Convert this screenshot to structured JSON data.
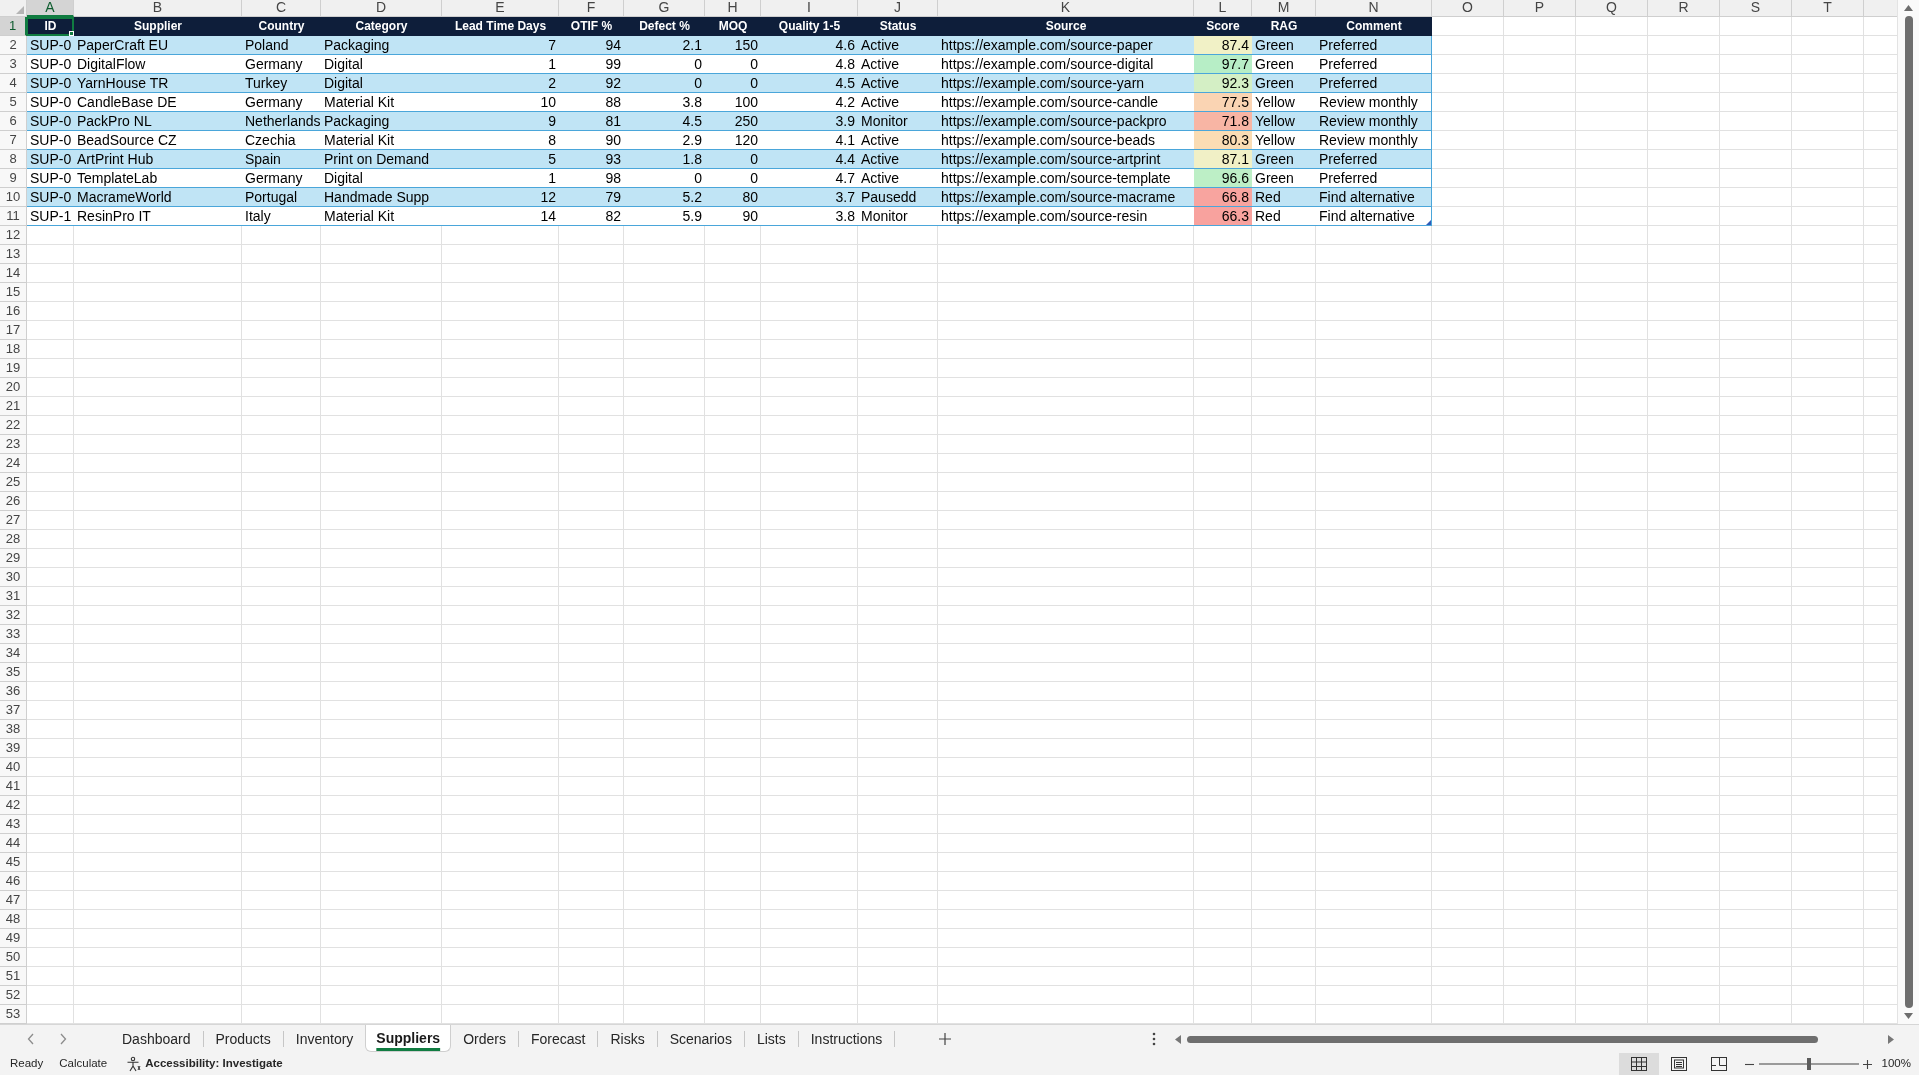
{
  "sheet": {
    "column_letters": [
      {
        "label": "A",
        "selected": true
      },
      {
        "label": "B",
        "selected": false
      },
      {
        "label": "C",
        "selected": false
      },
      {
        "label": "D",
        "selected": false
      },
      {
        "label": "E",
        "selected": false
      },
      {
        "label": "F",
        "selected": false
      },
      {
        "label": "G",
        "selected": false
      },
      {
        "label": "H",
        "selected": false
      },
      {
        "label": "I",
        "selected": false
      },
      {
        "label": "J",
        "selected": false
      },
      {
        "label": "K",
        "selected": false
      },
      {
        "label": "L",
        "selected": false
      },
      {
        "label": "M",
        "selected": false
      },
      {
        "label": "N",
        "selected": false
      },
      {
        "label": "O",
        "selected": false
      },
      {
        "label": "P",
        "selected": false
      },
      {
        "label": "Q",
        "selected": false
      },
      {
        "label": "R",
        "selected": false
      },
      {
        "label": "S",
        "selected": false
      },
      {
        "label": "T",
        "selected": false
      }
    ],
    "row_numbers": [
      {
        "label": "1",
        "selected": true
      },
      {
        "label": "2",
        "selected": false
      },
      {
        "label": "3",
        "selected": false
      },
      {
        "label": "4",
        "selected": false
      },
      {
        "label": "5",
        "selected": false
      },
      {
        "label": "6",
        "selected": false
      },
      {
        "label": "7",
        "selected": false
      },
      {
        "label": "8",
        "selected": false
      },
      {
        "label": "9",
        "selected": false
      },
      {
        "label": "10",
        "selected": false
      },
      {
        "label": "11",
        "selected": false
      },
      {
        "label": "12",
        "selected": false
      },
      {
        "label": "13",
        "selected": false
      },
      {
        "label": "14",
        "selected": false
      },
      {
        "label": "15",
        "selected": false
      },
      {
        "label": "16",
        "selected": false
      },
      {
        "label": "17",
        "selected": false
      },
      {
        "label": "18",
        "selected": false
      },
      {
        "label": "19",
        "selected": false
      },
      {
        "label": "20",
        "selected": false
      },
      {
        "label": "21",
        "selected": false
      },
      {
        "label": "22",
        "selected": false
      },
      {
        "label": "23",
        "selected": false
      },
      {
        "label": "24",
        "selected": false
      },
      {
        "label": "25",
        "selected": false
      },
      {
        "label": "26",
        "selected": false
      },
      {
        "label": "27",
        "selected": false
      },
      {
        "label": "28",
        "selected": false
      },
      {
        "label": "29",
        "selected": false
      },
      {
        "label": "30",
        "selected": false
      },
      {
        "label": "31",
        "selected": false
      },
      {
        "label": "32",
        "selected": false
      },
      {
        "label": "33",
        "selected": false
      },
      {
        "label": "34",
        "selected": false
      },
      {
        "label": "35",
        "selected": false
      },
      {
        "label": "36",
        "selected": false
      },
      {
        "label": "37",
        "selected": false
      },
      {
        "label": "38",
        "selected": false
      },
      {
        "label": "39",
        "selected": false
      },
      {
        "label": "40",
        "selected": false
      },
      {
        "label": "41",
        "selected": false
      },
      {
        "label": "42",
        "selected": false
      },
      {
        "label": "43",
        "selected": false
      },
      {
        "label": "44",
        "selected": false
      },
      {
        "label": "45",
        "selected": false
      },
      {
        "label": "46",
        "selected": false
      },
      {
        "label": "47",
        "selected": false
      },
      {
        "label": "48",
        "selected": false
      },
      {
        "label": "49",
        "selected": false
      },
      {
        "label": "50",
        "selected": false
      },
      {
        "label": "51",
        "selected": false
      },
      {
        "label": "52",
        "selected": false
      },
      {
        "label": "53",
        "selected": false
      }
    ]
  },
  "table": {
    "columns": [
      {
        "label": "ID",
        "kind": "text"
      },
      {
        "label": "Supplier",
        "kind": "text"
      },
      {
        "label": "Country",
        "kind": "text"
      },
      {
        "label": "Category",
        "kind": "text"
      },
      {
        "label": "Lead Time Days",
        "kind": "number"
      },
      {
        "label": "OTIF %",
        "kind": "number"
      },
      {
        "label": "Defect %",
        "kind": "number"
      },
      {
        "label": "MOQ",
        "kind": "number"
      },
      {
        "label": "Quality 1-5",
        "kind": "number"
      },
      {
        "label": "Status",
        "kind": "text"
      },
      {
        "label": "Source",
        "kind": "text"
      },
      {
        "label": "Score",
        "kind": "scale"
      },
      {
        "label": "RAG",
        "kind": "text"
      },
      {
        "label": "Comment",
        "kind": "text"
      }
    ],
    "rows": [
      {
        "cells": [
          "SUP-0",
          "PaperCraft EU",
          "Poland",
          "Packaging",
          "7",
          "94",
          "2.1",
          "150",
          "4.6",
          "Active",
          "https://example.com/source-paper",
          {
            "text": "87.4",
            "color": "#f1f1c6"
          },
          "Green",
          "Preferred"
        ]
      },
      {
        "cells": [
          "SUP-0",
          "DigitalFlow",
          "Germany",
          "Digital",
          "1",
          "99",
          "0",
          "0",
          "4.8",
          "Active",
          "https://example.com/source-digital",
          {
            "text": "97.7",
            "color": "#b7eec6"
          },
          "Green",
          "Preferred"
        ]
      },
      {
        "cells": [
          "SUP-0",
          "YarnHouse TR",
          "Turkey",
          "Digital",
          "2",
          "92",
          "0",
          "0",
          "4.5",
          "Active",
          "https://example.com/source-yarn",
          {
            "text": "92.3",
            "color": "#d4efc5"
          },
          "Green",
          "Preferred"
        ]
      },
      {
        "cells": [
          "SUP-0",
          "CandleBase DE",
          "Germany",
          "Material Kit",
          "10",
          "88",
          "3.8",
          "100",
          "4.2",
          "Active",
          "https://example.com/source-candle",
          {
            "text": "77.5",
            "color": "#fad4b3"
          },
          "Yellow",
          "Review monthly"
        ]
      },
      {
        "cells": [
          "SUP-0",
          "PackPro NL",
          "Netherlands",
          "Packaging",
          "9",
          "81",
          "4.5",
          "250",
          "3.9",
          "Monitor",
          "https://example.com/source-packpro",
          {
            "text": "71.8",
            "color": "#f8b5a4"
          },
          "Yellow",
          "Review monthly"
        ]
      },
      {
        "cells": [
          "SUP-0",
          "BeadSource CZ",
          "Czechia",
          "Material Kit",
          "8",
          "90",
          "2.9",
          "120",
          "4.1",
          "Active",
          "https://example.com/source-beads",
          {
            "text": "80.3",
            "color": "#fadcb4"
          },
          "Yellow",
          "Review monthly"
        ]
      },
      {
        "cells": [
          "SUP-0",
          "ArtPrint Hub",
          "Spain",
          "Print on Demand",
          "5",
          "93",
          "1.8",
          "0",
          "4.4",
          "Active",
          "https://example.com/source-artprint",
          {
            "text": "87.1",
            "color": "#f1f0c6"
          },
          "Green",
          "Preferred"
        ]
      },
      {
        "cells": [
          "SUP-0",
          "TemplateLab",
          "Germany",
          "Digital",
          "1",
          "98",
          "0",
          "0",
          "4.7",
          "Active",
          "https://example.com/source-template",
          {
            "text": "96.6",
            "color": "#bdefc6"
          },
          "Green",
          "Preferred"
        ]
      },
      {
        "cells": [
          "SUP-0",
          "MacrameWorld",
          "Portugal",
          "Handmade Supp",
          "12",
          "79",
          "5.2",
          "80",
          "3.7",
          "Pausedd",
          "https://example.com/source-macrame",
          {
            "text": "66.8",
            "color": "#f8a49f"
          },
          "Red",
          "Find alternative"
        ]
      },
      {
        "cells": [
          "SUP-1",
          "ResinPro IT",
          "Italy",
          "Material Kit",
          "14",
          "82",
          "5.9",
          "90",
          "3.8",
          "Monitor",
          "https://example.com/source-resin",
          {
            "text": "66.3",
            "color": "#f8a29e"
          },
          "Red",
          "Find alternative"
        ]
      }
    ]
  },
  "sheet_tabs": [
    {
      "label": "Dashboard",
      "selected": false
    },
    {
      "label": "Products",
      "selected": false
    },
    {
      "label": "Inventory",
      "selected": false
    },
    {
      "label": "Suppliers",
      "selected": true
    },
    {
      "label": "Orders",
      "selected": false
    },
    {
      "label": "Forecast",
      "selected": false
    },
    {
      "label": "Risks",
      "selected": false
    },
    {
      "label": "Scenarios",
      "selected": false
    },
    {
      "label": "Lists",
      "selected": false
    },
    {
      "label": "Instructions",
      "selected": false
    }
  ],
  "status_bar": {
    "items": [
      "Ready",
      "Calculate"
    ],
    "accessibility": "Accessibility: Investigate",
    "views": [
      {
        "kind": "normal",
        "selected": true
      },
      {
        "kind": "page_layout",
        "selected": false
      },
      {
        "kind": "page_break",
        "selected": false
      }
    ],
    "zoom": {
      "level": 0.5,
      "label": "100%"
    }
  }
}
